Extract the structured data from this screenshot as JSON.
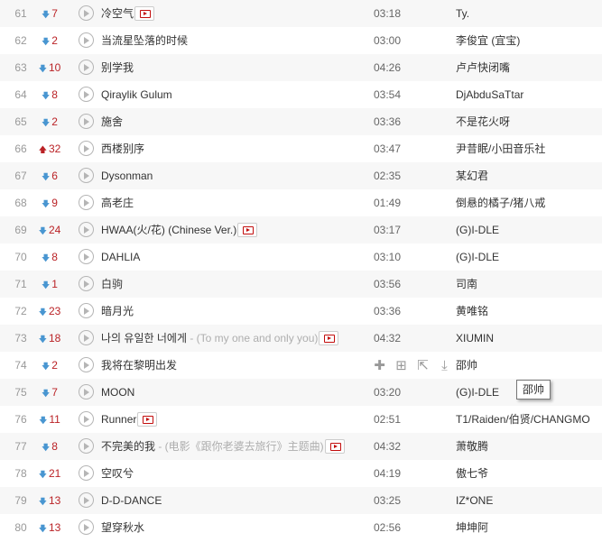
{
  "colors": {
    "accent": "#ba2226",
    "down": "#4996d1",
    "row_alt": "#f7f7f7"
  },
  "rows": [
    {
      "rank": "61",
      "dir": "down",
      "change": "7",
      "title": "冷空气",
      "sub": "",
      "mv": true,
      "duration": "03:18",
      "artist": "Ty."
    },
    {
      "rank": "62",
      "dir": "down",
      "change": "2",
      "title": "当流星坠落的时候",
      "sub": "",
      "mv": false,
      "duration": "03:00",
      "artist": "李俊宜 (宜宝)"
    },
    {
      "rank": "63",
      "dir": "down",
      "change": "10",
      "title": "别学我",
      "sub": "",
      "mv": false,
      "duration": "04:26",
      "artist": "卢卢快闭嘴"
    },
    {
      "rank": "64",
      "dir": "down",
      "change": "8",
      "title": "Qiraylik Gulum",
      "sub": "",
      "mv": false,
      "duration": "03:54",
      "artist": "DjAbduSaTtar"
    },
    {
      "rank": "65",
      "dir": "down",
      "change": "2",
      "title": "施舍",
      "sub": "",
      "mv": false,
      "duration": "03:36",
      "artist": "不是花火呀"
    },
    {
      "rank": "66",
      "dir": "up",
      "change": "32",
      "title": "西楼别序",
      "sub": "",
      "mv": false,
      "duration": "03:47",
      "artist": "尹昔眠/小田音乐社"
    },
    {
      "rank": "67",
      "dir": "down",
      "change": "6",
      "title": "Dysonman",
      "sub": "",
      "mv": false,
      "duration": "02:35",
      "artist": "某幻君"
    },
    {
      "rank": "68",
      "dir": "down",
      "change": "9",
      "title": "高老庄",
      "sub": "",
      "mv": false,
      "duration": "01:49",
      "artist": "倒悬的橘子/猪八戒"
    },
    {
      "rank": "69",
      "dir": "down",
      "change": "24",
      "title": "HWAA(火/花) (Chinese Ver.)",
      "sub": "",
      "mv": true,
      "duration": "03:17",
      "artist": "(G)I-DLE"
    },
    {
      "rank": "70",
      "dir": "down",
      "change": "8",
      "title": "DAHLIA",
      "sub": "",
      "mv": false,
      "duration": "03:10",
      "artist": "(G)I-DLE"
    },
    {
      "rank": "71",
      "dir": "down",
      "change": "1",
      "title": "白驹",
      "sub": "",
      "mv": false,
      "duration": "03:56",
      "artist": "司南"
    },
    {
      "rank": "72",
      "dir": "down",
      "change": "23",
      "title": "暗月光",
      "sub": "",
      "mv": false,
      "duration": "03:36",
      "artist": "黄唯铭"
    },
    {
      "rank": "73",
      "dir": "down",
      "change": "18",
      "title": "나의 유일한 너에게",
      "sub": " - (To my one and only you)",
      "mv": true,
      "duration": "04:32",
      "artist": "XIUMIN"
    },
    {
      "rank": "74",
      "dir": "down",
      "change": "2",
      "title": "我将在黎明出发",
      "sub": "",
      "mv": false,
      "duration": "",
      "hover": true,
      "artist": "邵帅"
    },
    {
      "rank": "75",
      "dir": "down",
      "change": "7",
      "title": "MOON",
      "sub": "",
      "mv": false,
      "duration": "03:20",
      "artist": "(G)I-DLE"
    },
    {
      "rank": "76",
      "dir": "down",
      "change": "11",
      "title": "Runner",
      "sub": "",
      "mv": true,
      "duration": "02:51",
      "artist": "T1/Raiden/伯贤/CHANGMO"
    },
    {
      "rank": "77",
      "dir": "down",
      "change": "8",
      "title": "不完美的我",
      "sub": " - (电影《跟你老婆去旅行》主题曲)",
      "mv": true,
      "duration": "04:32",
      "artist": "萧敬腾"
    },
    {
      "rank": "78",
      "dir": "down",
      "change": "21",
      "title": "空叹兮",
      "sub": "",
      "mv": false,
      "duration": "04:19",
      "artist": "傲七爷"
    },
    {
      "rank": "79",
      "dir": "down",
      "change": "13",
      "title": "D-D-DANCE",
      "sub": "",
      "mv": false,
      "duration": "03:25",
      "artist": "IZ*ONE"
    },
    {
      "rank": "80",
      "dir": "down",
      "change": "13",
      "title": "望穿秋水",
      "sub": "",
      "mv": false,
      "duration": "02:56",
      "artist": "坤坤阿"
    }
  ],
  "hover_ops": [
    "add-icon",
    "add-to-playlist-icon",
    "share-icon",
    "download-icon"
  ],
  "tooltip": "邵帅"
}
